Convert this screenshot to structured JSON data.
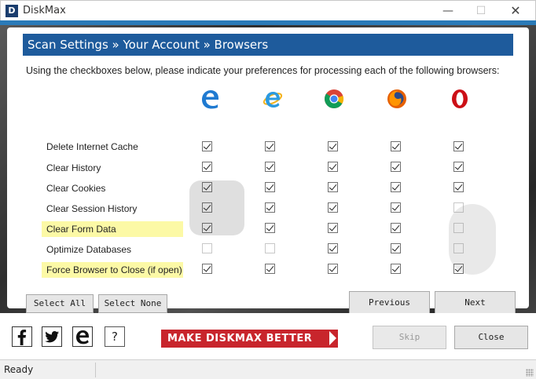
{
  "window": {
    "logo_text": "D",
    "title": "DiskMax",
    "minimize_glyph": "—",
    "maximize_glyph": "☐",
    "close_glyph": "✕"
  },
  "header": {
    "title": "Scan Settings  »  Your Account » Browsers"
  },
  "intro_text": "Using the checkboxes below, please indicate your preferences for processing each of the following browsers:",
  "browsers": [
    {
      "name": "Microsoft Edge",
      "icon": "edge-icon"
    },
    {
      "name": "Internet Explorer",
      "icon": "ie-icon"
    },
    {
      "name": "Google Chrome",
      "icon": "chrome-icon"
    },
    {
      "name": "Mozilla Firefox",
      "icon": "firefox-icon"
    },
    {
      "name": "Opera",
      "icon": "opera-icon"
    }
  ],
  "rows": [
    {
      "label": "Delete Internet Cache",
      "highlight": false,
      "checks": [
        true,
        true,
        true,
        true,
        true
      ],
      "enabled": [
        true,
        true,
        true,
        true,
        true
      ]
    },
    {
      "label": "Clear History",
      "highlight": false,
      "checks": [
        true,
        true,
        true,
        true,
        true
      ],
      "enabled": [
        true,
        true,
        true,
        true,
        true
      ]
    },
    {
      "label": "Clear Cookies",
      "highlight": false,
      "checks": [
        true,
        true,
        true,
        true,
        true
      ],
      "enabled": [
        true,
        true,
        true,
        true,
        true
      ]
    },
    {
      "label": "Clear Session History",
      "highlight": false,
      "checks": [
        true,
        true,
        true,
        true,
        false
      ],
      "enabled": [
        true,
        true,
        true,
        true,
        false
      ]
    },
    {
      "label": "Clear Form Data",
      "highlight": true,
      "checks": [
        true,
        true,
        true,
        true,
        false
      ],
      "enabled": [
        true,
        true,
        true,
        true,
        false
      ]
    },
    {
      "label": "Optimize Databases",
      "highlight": false,
      "checks": [
        false,
        false,
        true,
        true,
        false
      ],
      "enabled": [
        false,
        false,
        true,
        true,
        false
      ]
    },
    {
      "label": "Force Browser to Close (if open)",
      "highlight": true,
      "checks": [
        true,
        true,
        true,
        true,
        true
      ],
      "enabled": [
        true,
        true,
        true,
        true,
        true
      ]
    }
  ],
  "buttons": {
    "select_all": "Select All",
    "select_none": "Select None",
    "previous": "Previous",
    "next": "Next",
    "skip": "Skip",
    "close": "Close"
  },
  "bottom": {
    "make_better": "MAKE DISKMAX BETTER",
    "help_glyph": "?",
    "social_icons": [
      "facebook-icon",
      "twitter-icon",
      "ie-icon",
      "help-icon"
    ]
  },
  "status": {
    "text": "Ready"
  },
  "colors": {
    "header_blue": "#1e5b9c",
    "highlight_yellow": "#fcf9a6",
    "make_better_red": "#c8252c"
  }
}
